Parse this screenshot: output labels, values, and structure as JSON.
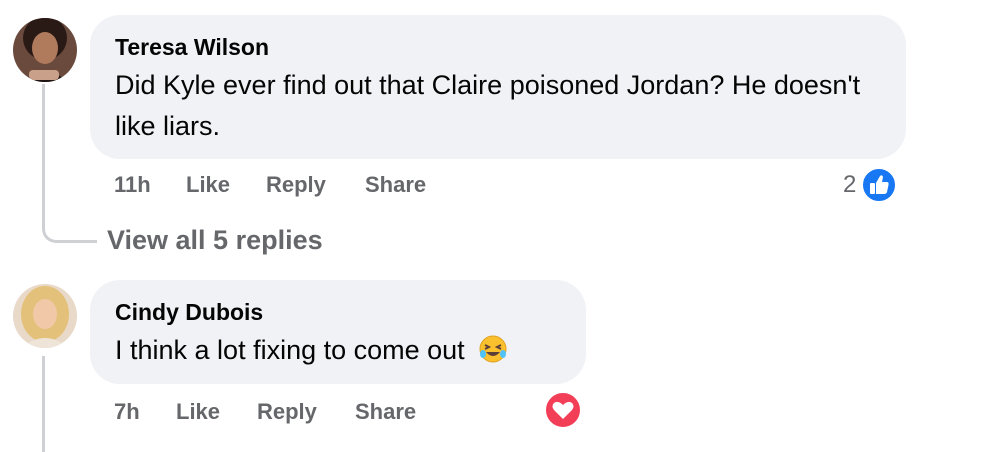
{
  "comments": [
    {
      "author": "Teresa Wilson",
      "text": "Did Kyle ever find out that Claire poisoned Jordan? He doesn't like liars.",
      "time": "11h",
      "like_label": "Like",
      "reply_label": "Reply",
      "share_label": "Share",
      "reaction_count": "2",
      "reaction_icon": "like-icon",
      "reaction_color": "#1877f2"
    },
    {
      "author": "Cindy Dubois",
      "text": "I think a lot fixing to come out",
      "emoji": "rolling-on-floor-laughing-emoji",
      "time": "7h",
      "like_label": "Like",
      "reply_label": "Reply",
      "share_label": "Share",
      "reaction_icon": "love-icon",
      "reaction_color": "#f33e58"
    }
  ],
  "thread": {
    "view_replies_label": "View all 5 replies"
  },
  "colors": {
    "bubble": "#f0f2f5",
    "secondary_text": "#65676b",
    "thread_line": "#ced0d4"
  }
}
